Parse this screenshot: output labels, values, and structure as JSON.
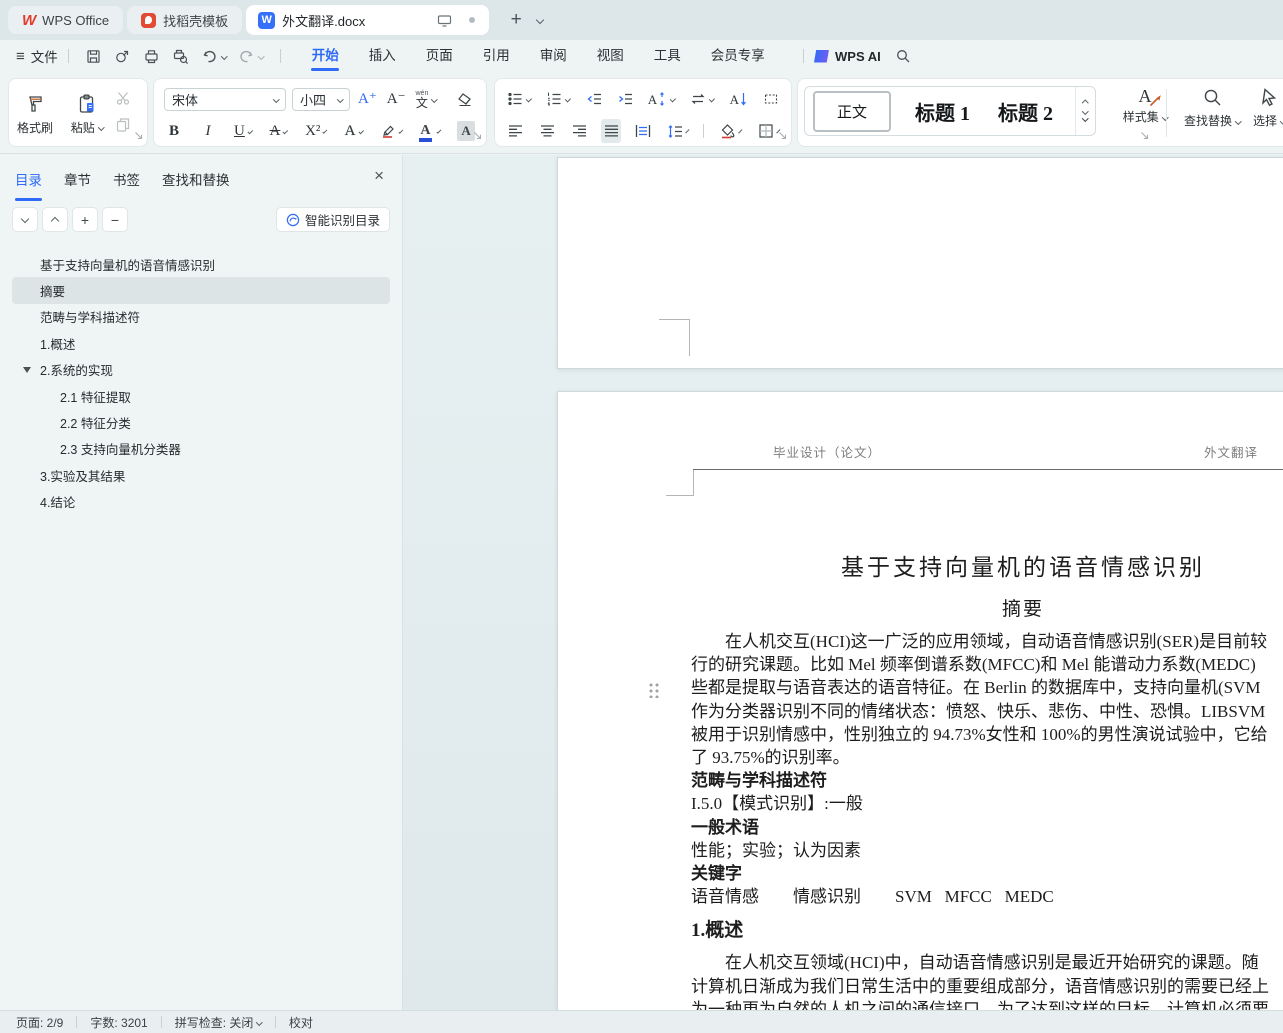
{
  "icons": {
    "plus": "+",
    "close": "×",
    "menu": "≡"
  },
  "tabbar": {
    "tabs": [
      {
        "label": "WPS Office"
      },
      {
        "label": "找稻壳模板"
      },
      {
        "label": "外文翻译.docx"
      }
    ]
  },
  "menubar": {
    "file": "文件",
    "tabs": [
      "开始",
      "插入",
      "页面",
      "引用",
      "审阅",
      "视图",
      "工具",
      "会员专享"
    ],
    "wps_ai": "WPS AI"
  },
  "ribbon": {
    "format_painter": "格式刷",
    "paste": "粘贴",
    "font_name": "宋体",
    "font_size": "小四",
    "glyphs": {
      "bold": "B",
      "italic": "I",
      "underline": "U",
      "strike": "A",
      "superscript": "X²",
      "effects": "A",
      "color": "A",
      "shade": "A",
      "grow": "A⁺",
      "shrink": "A⁻",
      "phonetic_top": "wén",
      "phonetic_bottom": "文",
      "scale": "A",
      "sort": "A"
    },
    "styles": [
      "正文",
      "标题 1",
      "标题 2"
    ],
    "style_set": "样式集",
    "find_replace": "查找替换",
    "select": "选择"
  },
  "sidebar": {
    "tabs": [
      "目录",
      "章节",
      "书签",
      "查找和替换"
    ],
    "smart_toc": "智能识别目录",
    "toc": [
      {
        "label": "基于支持向量机的语音情感识别"
      },
      {
        "label": "摘要"
      },
      {
        "label": "范畴与学科描述符"
      },
      {
        "label": "1.概述"
      },
      {
        "label": "2.系统的实现"
      },
      {
        "label": "2.1 特征提取"
      },
      {
        "label": "2.2 特征分类"
      },
      {
        "label": "2.3 支持向量机分类器"
      },
      {
        "label": "3.实验及其结果"
      },
      {
        "label": "4.结论"
      }
    ]
  },
  "document": {
    "header_left": "毕业设计（论文）",
    "header_right": "外文翻译",
    "title": "基于支持向量机的语音情感识别",
    "abstract_heading": "摘要",
    "lines": [
      "在人机交互(HCI)这一广泛的应用领域，自动语音情感识别(SER)是目前较",
      "行的研究课题。比如 Mel 频率倒谱系数(MFCC)和 Mel 能谱动力系数(MEDC)",
      "些都是提取与语音表达的语音特征。在 Berlin 的数据库中，支持向量机(SVM",
      "作为分类器识别不同的情绪状态：愤怒、快乐、悲伤、中性、恐惧。LIBSVM",
      "被用于识别情感中，性别独立的 94.73%女性和 100%的男性演说试验中，它给",
      "了 93.75%的识别率。",
      "范畴与学科描述符",
      "I.5.0【模式识别】:一般",
      "一般术语",
      "性能；实验；认为因素",
      "关键字",
      "语音情感　　情感识别　　SVM   MFCC   MEDC"
    ],
    "section_heading": "1.概述",
    "intro_lines": [
      "在人机交互领域(HCI)中，自动语音情感识别是最近开始研究的课题。随",
      "计算机日渐成为我们日常生活中的重要组成部分，语音情感识别的需要已经上",
      "为一种更为自然的人机之间的通信接口。为了达到这样的目标，计算机必须要"
    ]
  },
  "statusbar": {
    "page": "页面: 2/9",
    "words": "字数: 3201",
    "spellcheck": "拼写检查: 关闭",
    "proofread": "校对"
  },
  "colors": {
    "accent": "#2f6bf6",
    "wps_red": "#e23c2f",
    "doc_icon_blue": "#3470fa"
  }
}
